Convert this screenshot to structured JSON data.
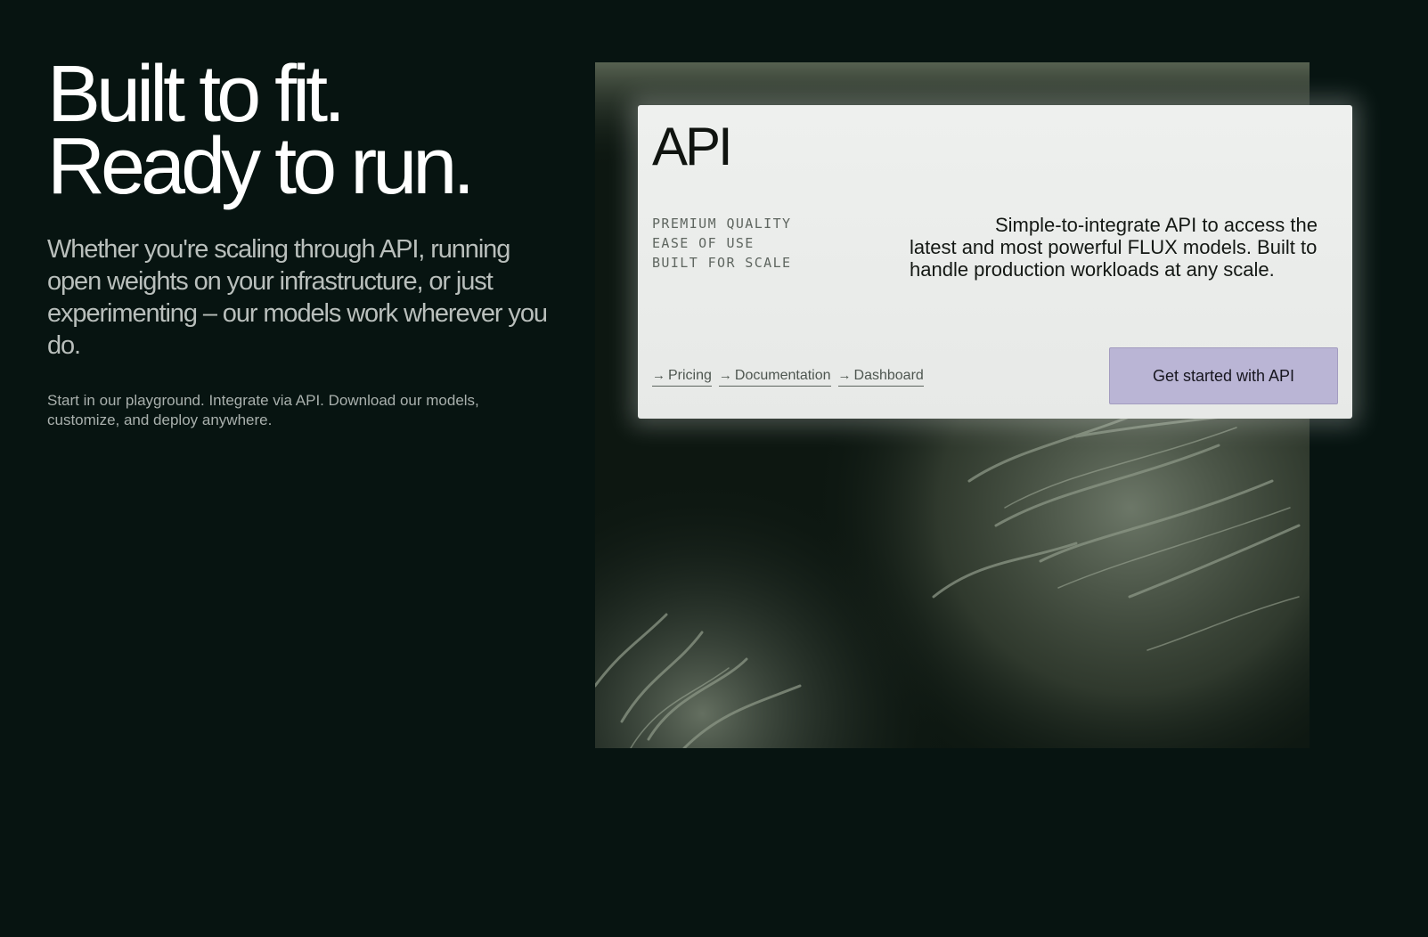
{
  "hero": {
    "headline_line1": "Built to fit.",
    "headline_line2": "Ready to run.",
    "lede": "Whether you're scaling through API, running open weights on your infrastructure, or just experimenting – our models work wherever you do.",
    "small": "Start in our playground. Integrate via API. Download our models, customize, and deploy anywhere."
  },
  "api_card": {
    "title": "API",
    "features": [
      "PREMIUM QUALITY",
      "EASE OF USE",
      "BUILT FOR SCALE"
    ],
    "description": "Simple-to-integrate API to access the latest and most powerful FLUX models. Built to handle production workloads at any scale.",
    "links": [
      {
        "label": "Pricing",
        "icon": "arrow-right-icon"
      },
      {
        "label": "Documentation",
        "icon": "arrow-right-icon"
      },
      {
        "label": "Dashboard",
        "icon": "arrow-right-icon"
      }
    ],
    "cta_label": "Get started with API"
  },
  "colors": {
    "background": "#071411",
    "card": "#eef0ee",
    "cta": "#bab5d5",
    "art_tint": "#8b9685"
  }
}
